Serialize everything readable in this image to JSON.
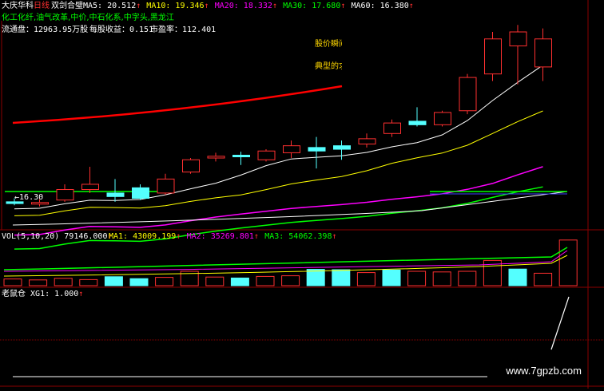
{
  "header": {
    "stock_name": "大庆华科",
    "period": "日线",
    "indicator": "双剑合璧",
    "ma": [
      {
        "label": "MA5:",
        "value": "20.512",
        "arrow": "↑",
        "color": "#ffffff"
      },
      {
        "label": "MA10:",
        "value": "19.346",
        "arrow": "↑",
        "color": "#ffff00"
      },
      {
        "label": "MA20:",
        "value": "18.332",
        "arrow": "↑",
        "color": "#ff00ff"
      },
      {
        "label": "MA30:",
        "value": "17.680",
        "arrow": "↑",
        "color": "#00ff00"
      },
      {
        "label": "MA60:",
        "value": "16.380",
        "arrow": "↑",
        "color": "#ffffff"
      }
    ],
    "concepts": "化工化纤,油气改革,中价,中石化系,中字头,黑龙江",
    "float_shares_label": "流通盘：",
    "float_shares_value": "12963.95万股",
    "eps_label": "每股收益：",
    "eps_value": "0.151",
    "pe_label": "市盈率：",
    "pe_value": "112.401"
  },
  "popup": {
    "line1": "股价瞬间",
    "line2": "典型的求"
  },
  "price_annotation": "16.30",
  "volume_header": {
    "label": "VOL(5,10,20)",
    "value": "79146.000",
    "arrow": "↑",
    "ma": [
      {
        "label": "MA1:",
        "value": "43009.199",
        "arrow": "↑",
        "color": "#ffff00"
      },
      {
        "label": "MA2:",
        "value": "35269.801",
        "arrow": "↑",
        "color": "#ff00ff"
      },
      {
        "label": "MA3:",
        "value": "54062.398",
        "arrow": "↑",
        "color": "#00ff00"
      }
    ]
  },
  "signal_header": {
    "name": "老鼠仓",
    "label": "XG1:",
    "value": "1.000",
    "arrow": "↑"
  },
  "watermark": "www.7gpzb.com",
  "colors": {
    "up": "#ff3030",
    "down": "#54ffff",
    "grid": "#8b0000"
  },
  "chart_data": {
    "type": "candlestick",
    "candles": [
      {
        "o": 16.35,
        "h": 16.45,
        "l": 16.25,
        "c": 16.3
      },
      {
        "o": 16.32,
        "h": 16.42,
        "l": 16.22,
        "c": 16.33
      },
      {
        "o": 16.4,
        "h": 16.85,
        "l": 16.35,
        "c": 16.7
      },
      {
        "o": 16.7,
        "h": 17.35,
        "l": 16.6,
        "c": 16.85
      },
      {
        "o": 16.6,
        "h": 17.0,
        "l": 16.35,
        "c": 16.5
      },
      {
        "o": 16.75,
        "h": 16.85,
        "l": 16.4,
        "c": 16.45
      },
      {
        "o": 16.6,
        "h": 17.15,
        "l": 16.55,
        "c": 17.0
      },
      {
        "o": 17.2,
        "h": 17.6,
        "l": 17.15,
        "c": 17.55
      },
      {
        "o": 17.6,
        "h": 17.75,
        "l": 17.5,
        "c": 17.65
      },
      {
        "o": 17.68,
        "h": 17.78,
        "l": 17.4,
        "c": 17.66
      },
      {
        "o": 17.55,
        "h": 17.85,
        "l": 17.5,
        "c": 17.8
      },
      {
        "o": 17.75,
        "h": 18.1,
        "l": 17.6,
        "c": 17.95
      },
      {
        "o": 17.9,
        "h": 18.2,
        "l": 17.3,
        "c": 17.8
      },
      {
        "o": 17.95,
        "h": 18.1,
        "l": 17.55,
        "c": 17.85
      },
      {
        "o": 18.0,
        "h": 18.3,
        "l": 17.9,
        "c": 18.15
      },
      {
        "o": 18.3,
        "h": 18.7,
        "l": 18.2,
        "c": 18.6
      },
      {
        "o": 18.65,
        "h": 19.05,
        "l": 18.5,
        "c": 18.55
      },
      {
        "o": 18.55,
        "h": 18.95,
        "l": 18.5,
        "c": 18.9
      },
      {
        "o": 18.95,
        "h": 20.0,
        "l": 18.85,
        "c": 19.9
      },
      {
        "o": 20.0,
        "h": 21.2,
        "l": 19.8,
        "c": 21.0
      },
      {
        "o": 20.8,
        "h": 21.4,
        "l": 19.7,
        "c": 21.2
      },
      {
        "o": 20.2,
        "h": 21.3,
        "l": 19.8,
        "c": 21.0
      }
    ],
    "price_ylim": [
      15.55,
      21.2
    ],
    "volumes": [
      {
        "v": 26000,
        "up": true
      },
      {
        "v": 23000,
        "up": true
      },
      {
        "v": 28000,
        "up": true
      },
      {
        "v": 24000,
        "up": true
      },
      {
        "v": 33000,
        "up": false
      },
      {
        "v": 27000,
        "up": false
      },
      {
        "v": 31000,
        "up": true
      },
      {
        "v": 50000,
        "up": true
      },
      {
        "v": 32000,
        "up": true
      },
      {
        "v": 29000,
        "up": false
      },
      {
        "v": 34000,
        "up": true
      },
      {
        "v": 36000,
        "up": true
      },
      {
        "v": 56000,
        "up": false
      },
      {
        "v": 55000,
        "up": false
      },
      {
        "v": 46000,
        "up": true
      },
      {
        "v": 54000,
        "up": false
      },
      {
        "v": 50000,
        "up": true
      },
      {
        "v": 48000,
        "up": true
      },
      {
        "v": 50000,
        "up": true
      },
      {
        "v": 84000,
        "up": true
      },
      {
        "v": 57000,
        "up": false
      },
      {
        "v": 44000,
        "up": true
      },
      {
        "v": 148000,
        "up": true
      }
    ],
    "volume_ylim": [
      0,
      150000
    ],
    "xg1": [
      0,
      0,
      0,
      0,
      0,
      0,
      0,
      0,
      0,
      0,
      0,
      0,
      0,
      0,
      0,
      0,
      0,
      0,
      0,
      0,
      0,
      0,
      1
    ],
    "series_colors": {
      "ma5": "#ffffff",
      "ma10": "#ffff00",
      "ma20": "#ff00ff",
      "ma30": "#00ff00",
      "ma60": "#ffffff",
      "long": "#ff0000"
    }
  }
}
